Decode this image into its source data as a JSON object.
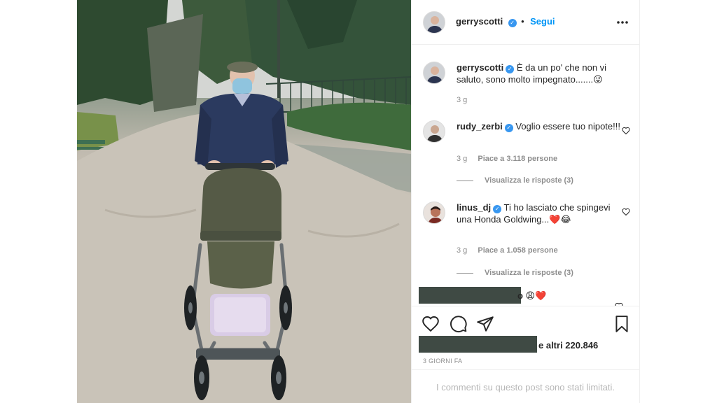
{
  "post": {
    "author": {
      "username": "gerryscotti",
      "verified": true,
      "follow_label": "Segui",
      "separator": "•"
    },
    "caption": {
      "username": "gerryscotti",
      "text": "È da un po' che non vi saluto, sono molto impegnato.......😜",
      "time": "3 g"
    },
    "comments": [
      {
        "username": "rudy_zerbi",
        "verified": true,
        "text": "Voglio essere tuo nipote!!!",
        "time": "3 g",
        "likes": "Piace a 3.118 persone",
        "replies": "Visualizza le risposte (3)"
      },
      {
        "username": "linus_dj",
        "verified": true,
        "text": "Ti ho lasciato che spingevi una Honda Goldwing...❤️😂",
        "time": "3 g",
        "likes": "Piace a 1.058 persone",
        "replies": "Visualizza le risposte (3)"
      },
      {
        "partial_text": "o 😩❤️"
      }
    ],
    "likes_summary": "e altri 220.846",
    "time_ago": "3 GIORNI FA",
    "comments_limited": "I commenti su questo post sono stati limitati."
  },
  "icons": {
    "more": "more-options-icon",
    "like": "heart-icon",
    "comment": "comment-bubble-icon",
    "share": "paper-plane-icon",
    "save": "bookmark-icon",
    "verified": "verified-badge-icon"
  },
  "colors": {
    "accent": "#0095f6",
    "verified": "#3897f0",
    "muted": "#8e8e8e",
    "redaction": "#3f4a44",
    "heart": "#ed4956"
  }
}
